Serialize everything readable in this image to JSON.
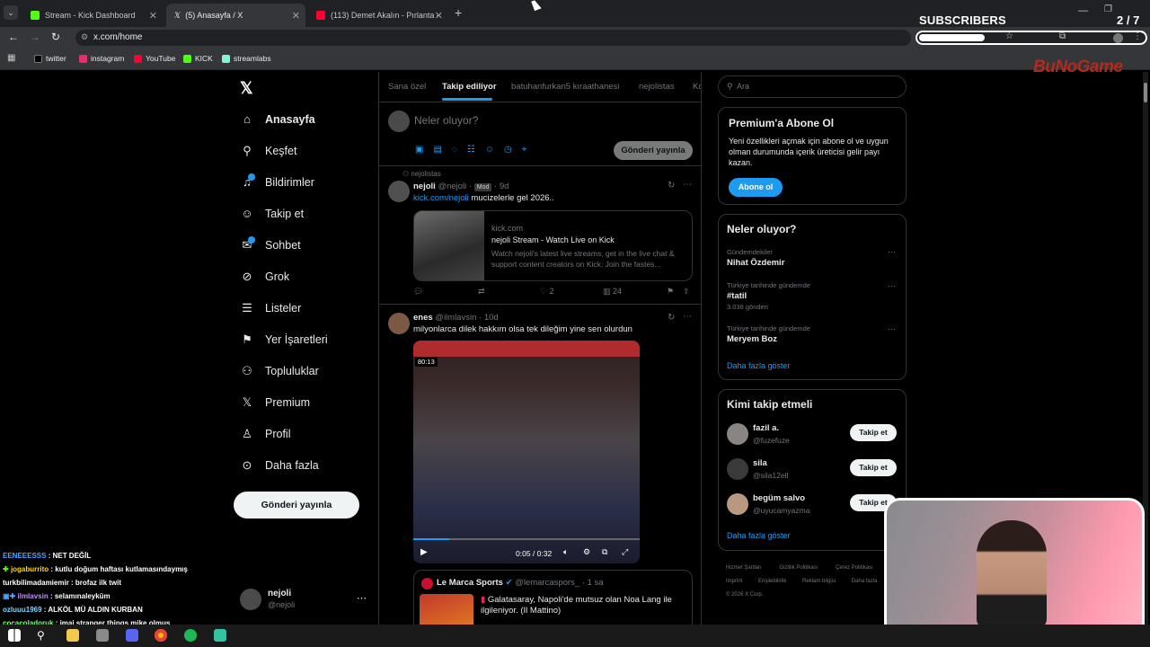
{
  "browser": {
    "tabs": [
      {
        "title": "Stream - Kick Dashboard",
        "color": "#53fc18"
      },
      {
        "title": "(5) Anasayfa / X",
        "color": "#ffffff"
      },
      {
        "title": "(113) Demet Akalın - Pırlanta -",
        "color": "#ff0033"
      }
    ],
    "new_tab": "+",
    "url": "x.com/home",
    "bookmarks": [
      "twitter",
      "instagram",
      "YouTube",
      "KICK",
      "streamlabs"
    ]
  },
  "overlay": {
    "subscribers_label": "SUBSCRIBERS",
    "subscribers_count": "2 / 7",
    "subscribers_progress": 0.29,
    "brand": "BuNoGame"
  },
  "nav": {
    "items": [
      "Anasayfa",
      "Keşfet",
      "Bildirimler",
      "Takip et",
      "Sohbet",
      "Grok",
      "Listeler",
      "Yer İşaretleri",
      "Topluluklar",
      "Premium",
      "Profil",
      "Daha fazla"
    ],
    "post_button": "Gönderi yayınla",
    "account_name": "nejoli",
    "account_handle": "@nejoli"
  },
  "feed": {
    "tabs": [
      "Sana özel",
      "Takip ediliyor",
      "batuhanfurkan5 kıraathanesi",
      "nejolistas",
      "Ko"
    ],
    "composer_placeholder": "Neler oluyor?",
    "composer_button": "Gönderi yayınla",
    "post1": {
      "context": "nejolistas",
      "name": "nejoli",
      "handle": "@nejoli",
      "badge": "Mod",
      "time": "9d",
      "link": "kick.com/nejoli",
      "text": "mucizelerle gel 2026..",
      "card_domain": "kick.com",
      "card_title": "nejoli Stream - Watch Live on Kick",
      "card_desc": "Watch nejoli's latest live streams, get in the live chat & support content creators on Kick. Join the fastes...",
      "likes": "2",
      "views": "24"
    },
    "post2": {
      "name": "enes",
      "handle": "@ilmlavsin",
      "time": "10d",
      "text": "milyonlarca dilek hakkım olsa tek dileğim yine sen olurdun",
      "video_badge": "80:13",
      "video_time": "0:05 / 0:32",
      "video_progress": 0.16
    },
    "quote": {
      "name": "Le Marca Sports",
      "handle": "@lemarcaspors_",
      "time": "1 sa",
      "text": "Galatasaray, Napoli'de mutsuz olan Noa Lang ile ilgileniyor. (Il Mattino)"
    }
  },
  "sidebar": {
    "search_placeholder": "Ara",
    "premium_title": "Premium'a Abone Ol",
    "premium_text": "Yeni özellikleri açmak için abone ol ve uygun olman durumunda içerik üreticisi gelir payı kazan.",
    "premium_button": "Abone ol",
    "trends_title": "Neler oluyor?",
    "trends": [
      {
        "context": "Gündemdekiler",
        "name": "Nihat Özdemir",
        "count": ""
      },
      {
        "context": "Türkiye tarihinde gündemde",
        "name": "#tatil",
        "count": "3.036 gönderi"
      },
      {
        "context": "Türkiye tarihinde gündemde",
        "name": "Meryem Boz",
        "count": ""
      }
    ],
    "trends_more": "Daha fazla göster",
    "who_title": "Kimi takip etmeli",
    "who": [
      {
        "name": "fazil a.",
        "handle": "@fuzefuze"
      },
      {
        "name": "sila",
        "handle": "@sila12ell"
      },
      {
        "name": "begüm salvo",
        "handle": "@uyucamyazma"
      }
    ],
    "follow_label": "Takip et",
    "who_more": "Daha fazla göster",
    "footer": [
      "Hizmet Şartları",
      "Gizlilik Politikası",
      "Çerez Politikası",
      "Imprint",
      "Erişilebilirlik",
      "Reklam bilgisi",
      "Daha fazla",
      "© 2026 X Corp."
    ]
  },
  "chat": [
    {
      "user": "EENEEESSS",
      "msg": "NET DEĞİL",
      "color": "#4fa3ff"
    },
    {
      "user": "jogaburrito",
      "msg": "kutlu doğum haftası kutlamasındaymış",
      "color": "#ffd700"
    },
    {
      "user": "turkbilimadamiemir",
      "msg": "brofaz ilk twit",
      "color": "#ffffff"
    },
    {
      "user": "ilmlavsin",
      "msg": "selamınaleyküm",
      "color": "#c48bff"
    },
    {
      "user": "ozluuu1969",
      "msg": "ALKÖL MÜ ALDIN KURBAN",
      "color": "#7fd7ff"
    },
    {
      "user": "cocacoladoruk",
      "msg": "imaj stranger things mike olmuş",
      "color": "#7fff7f"
    }
  ]
}
